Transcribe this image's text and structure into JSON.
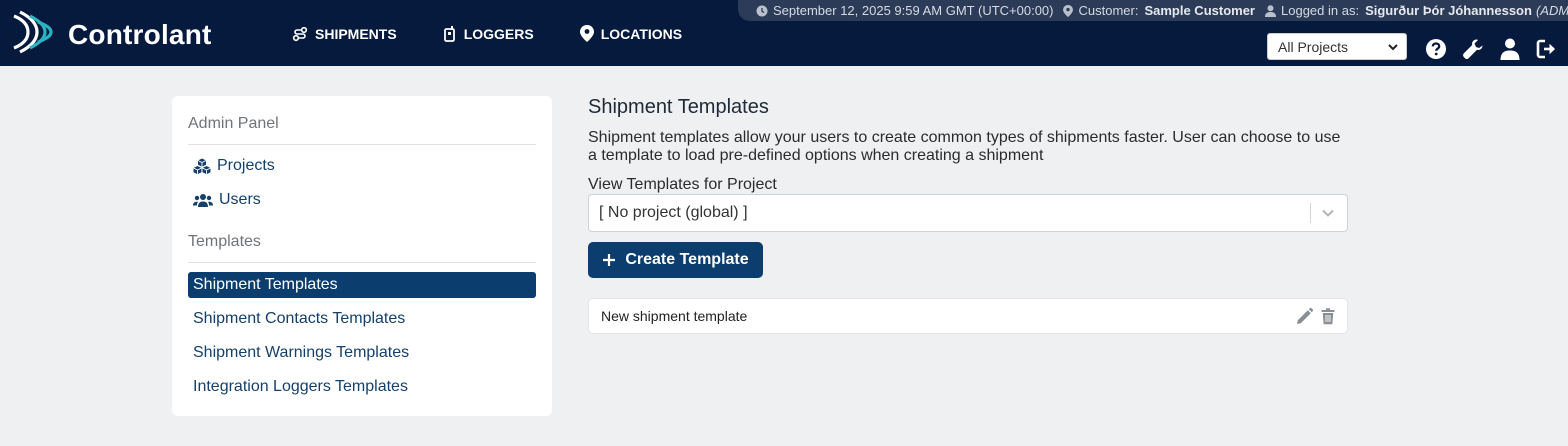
{
  "header": {
    "brand": "Controlant",
    "nav": [
      {
        "label": "SHIPMENTS",
        "icon": "route-icon"
      },
      {
        "label": "LOGGERS",
        "icon": "logger-icon"
      },
      {
        "label": "LOCATIONS",
        "icon": "location-pin-icon"
      }
    ],
    "status": {
      "datetime": "September 12, 2025 9:59 AM GMT (UTC+00:00)",
      "customer_label": "Customer:",
      "customer_value": "Sample Customer",
      "logged_label": "Logged in as:",
      "logged_user": "Sigurður Þór Jóhannesson",
      "logged_role": "(ADMIN)"
    },
    "project_select": "All Projects",
    "icons": [
      "help-icon",
      "wrench-icon",
      "user-icon",
      "logout-icon"
    ]
  },
  "sidebar": {
    "section1": "Admin Panel",
    "items1": [
      {
        "label": "Projects",
        "icon": "cubes-icon"
      },
      {
        "label": "Users",
        "icon": "users-icon"
      }
    ],
    "section2": "Templates",
    "items2": [
      {
        "label": "Shipment Templates",
        "active": true
      },
      {
        "label": "Shipment Contacts Templates"
      },
      {
        "label": "Shipment Warnings Templates"
      },
      {
        "label": "Integration Loggers Templates"
      }
    ]
  },
  "main": {
    "title": "Shipment Templates",
    "description": "Shipment templates allow your users to create common types of shipments faster. User can choose to use a template to load pre-defined options when creating a shipment",
    "select_label": "View Templates for Project",
    "select_value": "[ No project (global) ]",
    "create_button": "Create Template",
    "templates": [
      {
        "name": "New shipment template"
      }
    ]
  },
  "colors": {
    "header_bg": "#061a3e",
    "accent": "#0b3d6e",
    "logo_teal": "#2bb3c0"
  }
}
